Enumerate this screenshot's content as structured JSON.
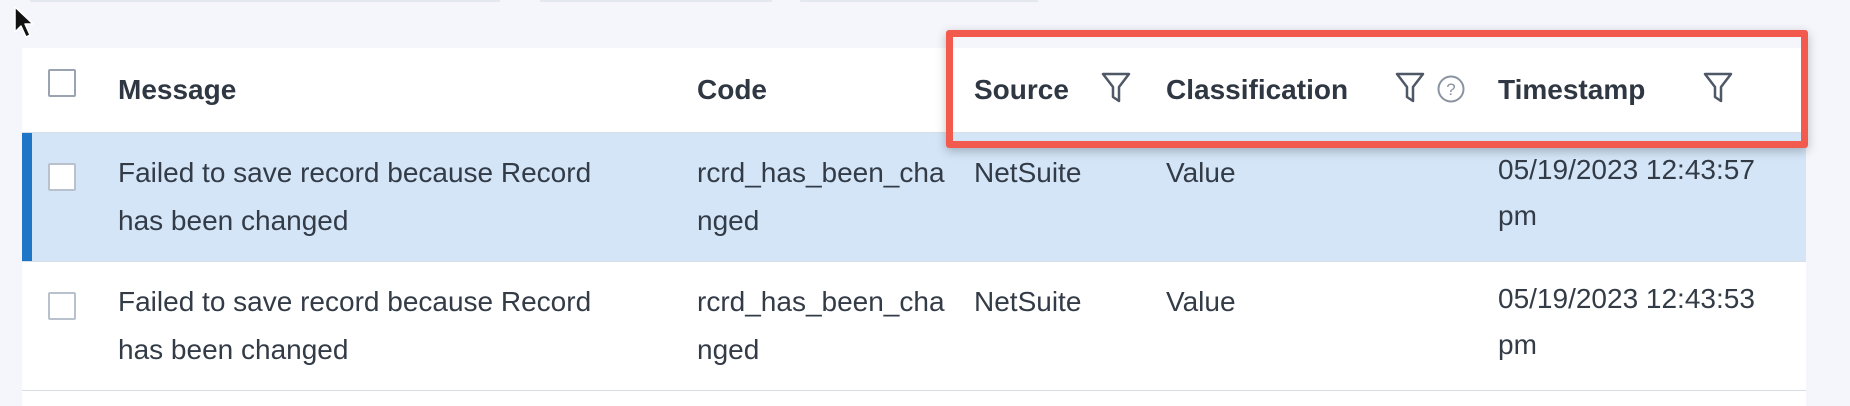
{
  "table": {
    "columns": {
      "message": "Message",
      "code": "Code",
      "source": "Source",
      "classification": "Classification",
      "timestamp": "Timestamp"
    },
    "rows": [
      {
        "message": "Failed to save record because Record has been changed",
        "code": "rcrd_has_been_changed",
        "source": "NetSuite",
        "classification": "Value",
        "timestamp": "05/19/2023 12:43:57 pm",
        "selected": true
      },
      {
        "message": "Failed to save record because Record has been changed",
        "code": "rcrd_has_been_changed",
        "source": "NetSuite",
        "classification": "Value",
        "timestamp": "05/19/2023 12:43:53 pm",
        "selected": false
      }
    ]
  },
  "icons": {
    "filter": "filter-icon",
    "help": "help-circle-icon",
    "pointer": "mouse-pointer-icon"
  },
  "colors": {
    "highlight_border": "#f25a4e",
    "selected_row_bg": "#d3e5f7",
    "selected_row_accent": "#1f76c6"
  }
}
